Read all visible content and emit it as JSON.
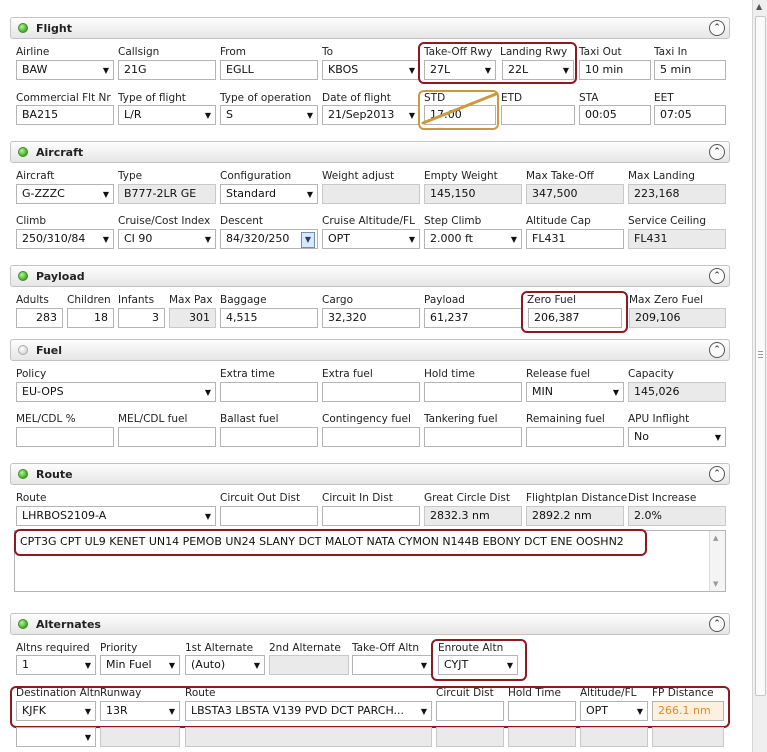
{
  "sections": {
    "flight": "Flight",
    "aircraft": "Aircraft",
    "payload": "Payload",
    "fuel": "Fuel",
    "route": "Route",
    "alternates": "Alternates"
  },
  "flight": {
    "labels": {
      "airline": "Airline",
      "callsign": "Callsign",
      "from": "From",
      "to": "To",
      "takeoff_rwy": "Take-Off Rwy",
      "landing_rwy": "Landing Rwy",
      "taxi_out": "Taxi Out",
      "taxi_in": "Taxi In",
      "commercial_flt": "Commercial Flt Nr",
      "type_of_flight": "Type of flight",
      "type_of_operation": "Type of operation",
      "date_of_flight": "Date of flight",
      "std": "STD",
      "etd": "ETD",
      "sta": "STA",
      "eet": "EET"
    },
    "values": {
      "airline": "BAW",
      "callsign": "21G",
      "from": "EGLL",
      "to": "KBOS",
      "takeoff_rwy": "27L",
      "landing_rwy": "22L",
      "taxi_out": "10 min",
      "taxi_in": "5 min",
      "commercial_flt": "BA215",
      "type_of_flight": "L/R",
      "type_of_operation": "S",
      "date_of_flight": "21/Sep2013",
      "std": "17:00",
      "etd": "",
      "sta": "00:05",
      "eet": "07:05"
    }
  },
  "aircraft": {
    "labels": {
      "aircraft": "Aircraft",
      "type": "Type",
      "configuration": "Configuration",
      "weight_adjust": "Weight adjust",
      "empty_weight": "Empty Weight",
      "max_takeoff": "Max Take-Off",
      "max_landing": "Max Landing",
      "climb": "Climb",
      "cruise_cost_index": "Cruise/Cost Index",
      "descent": "Descent",
      "cruise_altitude": "Cruise Altitude/FL",
      "step_climb": "Step Climb",
      "altitude_cap": "Altitude Cap",
      "service_ceiling": "Service Ceiling"
    },
    "values": {
      "aircraft": "G-ZZZC",
      "type": "B777-2LR GE",
      "configuration": "Standard",
      "weight_adjust": "",
      "empty_weight": "145,150",
      "max_takeoff": "347,500",
      "max_landing": "223,168",
      "climb": "250/310/84",
      "cruise_cost_index": "CI 90",
      "descent": "84/320/250",
      "cruise_altitude": "OPT",
      "step_climb": "2.000 ft",
      "altitude_cap": "FL431",
      "service_ceiling": "FL431"
    }
  },
  "payload": {
    "labels": {
      "adults": "Adults",
      "children": "Children",
      "infants": "Infants",
      "max_pax": "Max Pax",
      "baggage": "Baggage",
      "cargo": "Cargo",
      "payload": "Payload",
      "zero_fuel": "Zero Fuel",
      "max_zero_fuel": "Max Zero Fuel"
    },
    "values": {
      "adults": "283",
      "children": "18",
      "infants": "3",
      "max_pax": "301",
      "baggage": "4,515",
      "cargo": "32,320",
      "payload": "61,237",
      "zero_fuel": "206,387",
      "max_zero_fuel": "209,106"
    }
  },
  "fuel": {
    "labels": {
      "policy": "Policy",
      "extra_time": "Extra time",
      "extra_fuel": "Extra fuel",
      "hold_time": "Hold time",
      "release_fuel": "Release fuel",
      "capacity": "Capacity",
      "mel_cdl_pct": "MEL/CDL %",
      "mel_cdl_fuel": "MEL/CDL fuel",
      "ballast_fuel": "Ballast fuel",
      "contingency_fuel": "Contingency fuel",
      "tankering_fuel": "Tankering fuel",
      "remaining_fuel": "Remaining fuel",
      "apu_inflight": "APU Inflight"
    },
    "values": {
      "policy": "EU-OPS",
      "extra_time": "",
      "extra_fuel": "",
      "hold_time": "",
      "release_fuel": "MIN",
      "capacity": "145,026",
      "mel_cdl_pct": "",
      "mel_cdl_fuel": "",
      "ballast_fuel": "",
      "contingency_fuel": "",
      "tankering_fuel": "",
      "remaining_fuel": "",
      "apu_inflight": "No"
    }
  },
  "route": {
    "labels": {
      "route": "Route",
      "circuit_out": "Circuit Out Dist",
      "circuit_in": "Circuit In Dist",
      "great_circle": "Great Circle Dist",
      "flightplan_distance": "Flightplan Distance",
      "dist_increase": "Dist Increase"
    },
    "values": {
      "route": "LHRBOS2109-A",
      "circuit_out": "",
      "circuit_in": "",
      "great_circle": "2832.3 nm",
      "flightplan_distance": "2892.2 nm",
      "dist_increase": "2.0%"
    },
    "route_string": "CPT3G CPT UL9 KENET UN14 PEMOB UN24 SLANY DCT MALOT NATA CYMON N144B EBONY DCT ENE OOSHN2"
  },
  "alternates": {
    "labels": {
      "altns_required": "Altns required",
      "priority": "Priority",
      "first_alternate": "1st Alternate",
      "second_alternate": "2nd Alternate",
      "takeoff_altn": "Take-Off Altn",
      "enroute_altn": "Enroute Altn",
      "destination_altn": "Destination Altn",
      "runway": "Runway",
      "route": "Route",
      "circuit_dist": "Circuit Dist",
      "hold_time": "Hold Time",
      "altitude_fl": "Altitude/FL",
      "fp_distance": "FP Distance"
    },
    "values": {
      "altns_required": "1",
      "priority": "Min Fuel",
      "first_alternate": "(Auto)",
      "second_alternate": "",
      "takeoff_altn": "",
      "enroute_altn": "CYJT",
      "destination_altn": "KJFK",
      "runway": "13R",
      "route": "LBSTA3 LBSTA V139 PVD DCT PARCH...",
      "circuit_dist": "",
      "hold_time": "",
      "altitude_fl": "OPT",
      "fp_distance": "266.1 nm",
      "row2_destination": "",
      "row2_runway": "",
      "row2_route": "",
      "row2_circuit": "",
      "row2_hold": "",
      "row2_alt": "",
      "row2_fp": ""
    }
  },
  "icons": {
    "collapse": "chevron-up-icon",
    "dropdown": "chevron-down-icon",
    "status_on": "green-led-icon",
    "status_off": "gray-led-icon"
  },
  "colors": {
    "highlight": "#8c1a20",
    "std_highlight": "#cc9a3c",
    "status_green": "#3fae1e",
    "fp_distance_text": "#e08a2c"
  }
}
